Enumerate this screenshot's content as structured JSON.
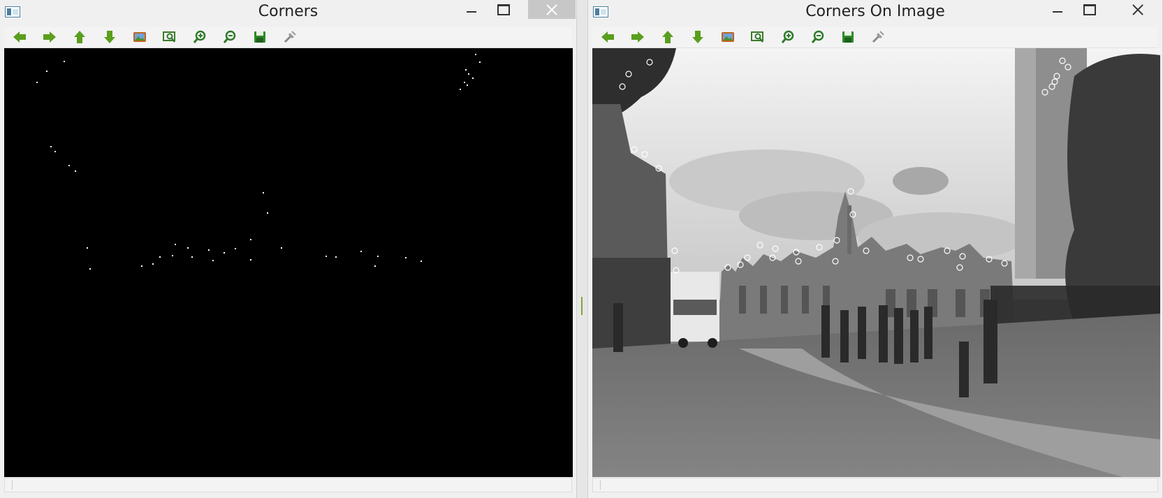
{
  "windows": [
    {
      "title": "Corners",
      "toolbar": [
        "pan-left-icon",
        "pan-right-icon",
        "pan-up-icon",
        "pan-down-icon",
        "zoom-to-fit-icon",
        "zoom-region-icon",
        "zoom-in-icon",
        "zoom-out-icon",
        "save-icon",
        "properties-icon"
      ],
      "image": "black corner-response map with sparse white detected corner points"
    },
    {
      "title": "Corners On Image",
      "toolbar": [
        "pan-left-icon",
        "pan-right-icon",
        "pan-up-icon",
        "pan-down-icon",
        "zoom-to-fit-icon",
        "zoom-region-icon",
        "zoom-in-icon",
        "zoom-out-icon",
        "save-icon",
        "properties-icon"
      ],
      "image": "grayscale street photo with circled corner markers on rooftops and trees"
    }
  ],
  "colors": {
    "toolbar_icon": "#5a9e1e",
    "close_hover": "#c7c7c7",
    "canvas_left": "#000000"
  }
}
